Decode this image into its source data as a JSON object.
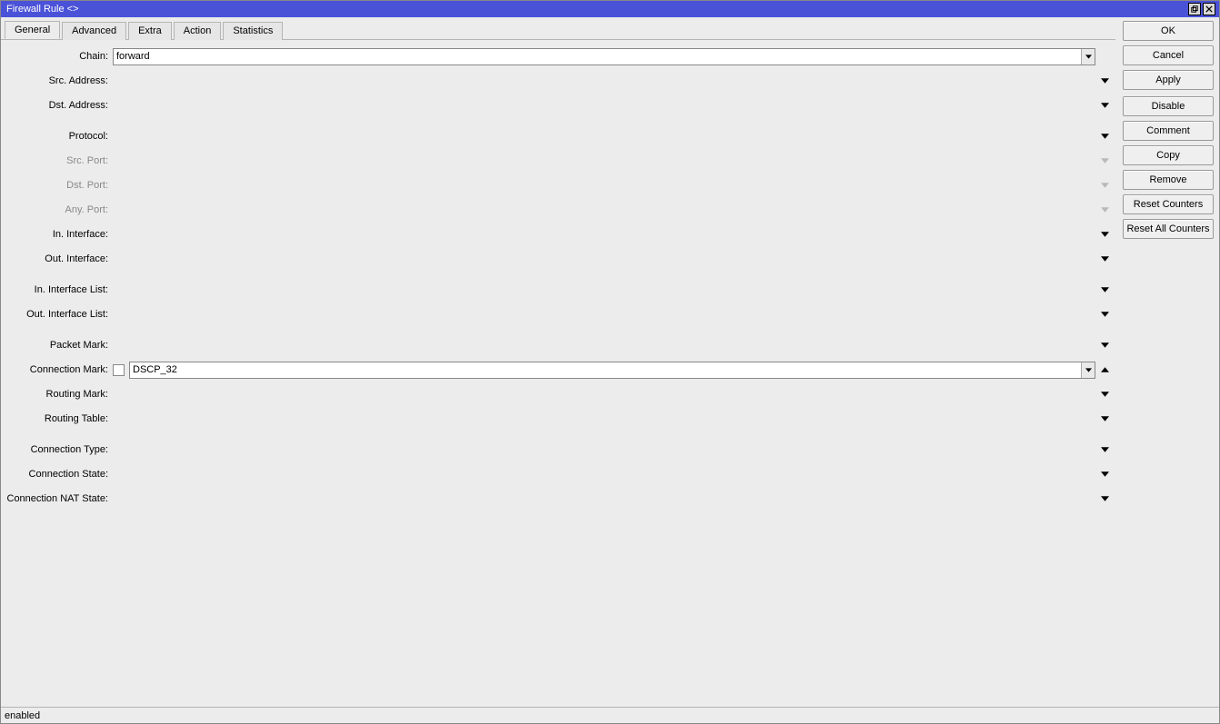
{
  "title": "Firewall Rule <>",
  "tabs": {
    "general": "General",
    "advanced": "Advanced",
    "extra": "Extra",
    "action": "Action",
    "statistics": "Statistics"
  },
  "labels": {
    "chain": "Chain:",
    "src_addr": "Src. Address:",
    "dst_addr": "Dst. Address:",
    "protocol": "Protocol:",
    "src_port": "Src. Port:",
    "dst_port": "Dst. Port:",
    "any_port": "Any. Port:",
    "in_iface": "In. Interface:",
    "out_iface": "Out. Interface:",
    "in_iface_list": "In. Interface List:",
    "out_iface_list": "Out. Interface List:",
    "packet_mark": "Packet Mark:",
    "conn_mark": "Connection Mark:",
    "routing_mark": "Routing Mark:",
    "routing_table": "Routing Table:",
    "conn_type": "Connection Type:",
    "conn_state": "Connection State:",
    "conn_nat_state": "Connection NAT State:"
  },
  "values": {
    "chain": "forward",
    "src_addr": "",
    "dst_addr": "",
    "protocol": "",
    "src_port": "",
    "dst_port": "",
    "any_port": "",
    "in_iface": "",
    "out_iface": "",
    "in_iface_list": "",
    "out_iface_list": "",
    "packet_mark": "",
    "conn_mark": "DSCP_32",
    "routing_mark": "",
    "routing_table": "",
    "conn_type": "",
    "conn_state": "",
    "conn_nat_state": ""
  },
  "conn_mark_invert": false,
  "buttons": {
    "ok": "OK",
    "cancel": "Cancel",
    "apply": "Apply",
    "disable": "Disable",
    "comment": "Comment",
    "copy": "Copy",
    "remove": "Remove",
    "reset_counters": "Reset Counters",
    "reset_all_counters": "Reset All Counters"
  },
  "status": "enabled"
}
